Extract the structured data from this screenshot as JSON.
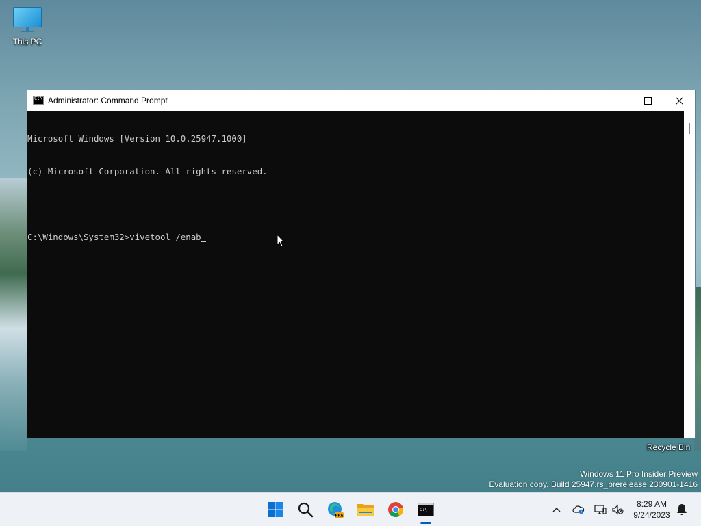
{
  "desktop": {
    "icons": [
      {
        "label": "This PC"
      },
      {
        "label": "Recycle Bin"
      }
    ],
    "watermark": {
      "line1": "Windows 11 Pro Insider Preview",
      "line2": "Evaluation copy. Build 25947.rs_prerelease.230901-1416"
    }
  },
  "window": {
    "title": "Administrator: Command Prompt",
    "console_lines": [
      "Microsoft Windows [Version 10.0.25947.1000]",
      "(c) Microsoft Corporation. All rights reserved.",
      "",
      "C:\\Windows\\System32>vivetool /enab"
    ]
  },
  "taskbar": {
    "apps": [
      "start-icon",
      "search-icon",
      "edge-pre-icon",
      "file-explorer-icon",
      "chrome-icon",
      "command-prompt-icon"
    ],
    "tray": [
      "chevron-up-icon",
      "onedrive-icon",
      "network-icon",
      "volume-muted-icon",
      "notification-bell-icon"
    ],
    "time": "8:29 AM",
    "date": "9/24/2023",
    "accent": "#005fb8"
  }
}
